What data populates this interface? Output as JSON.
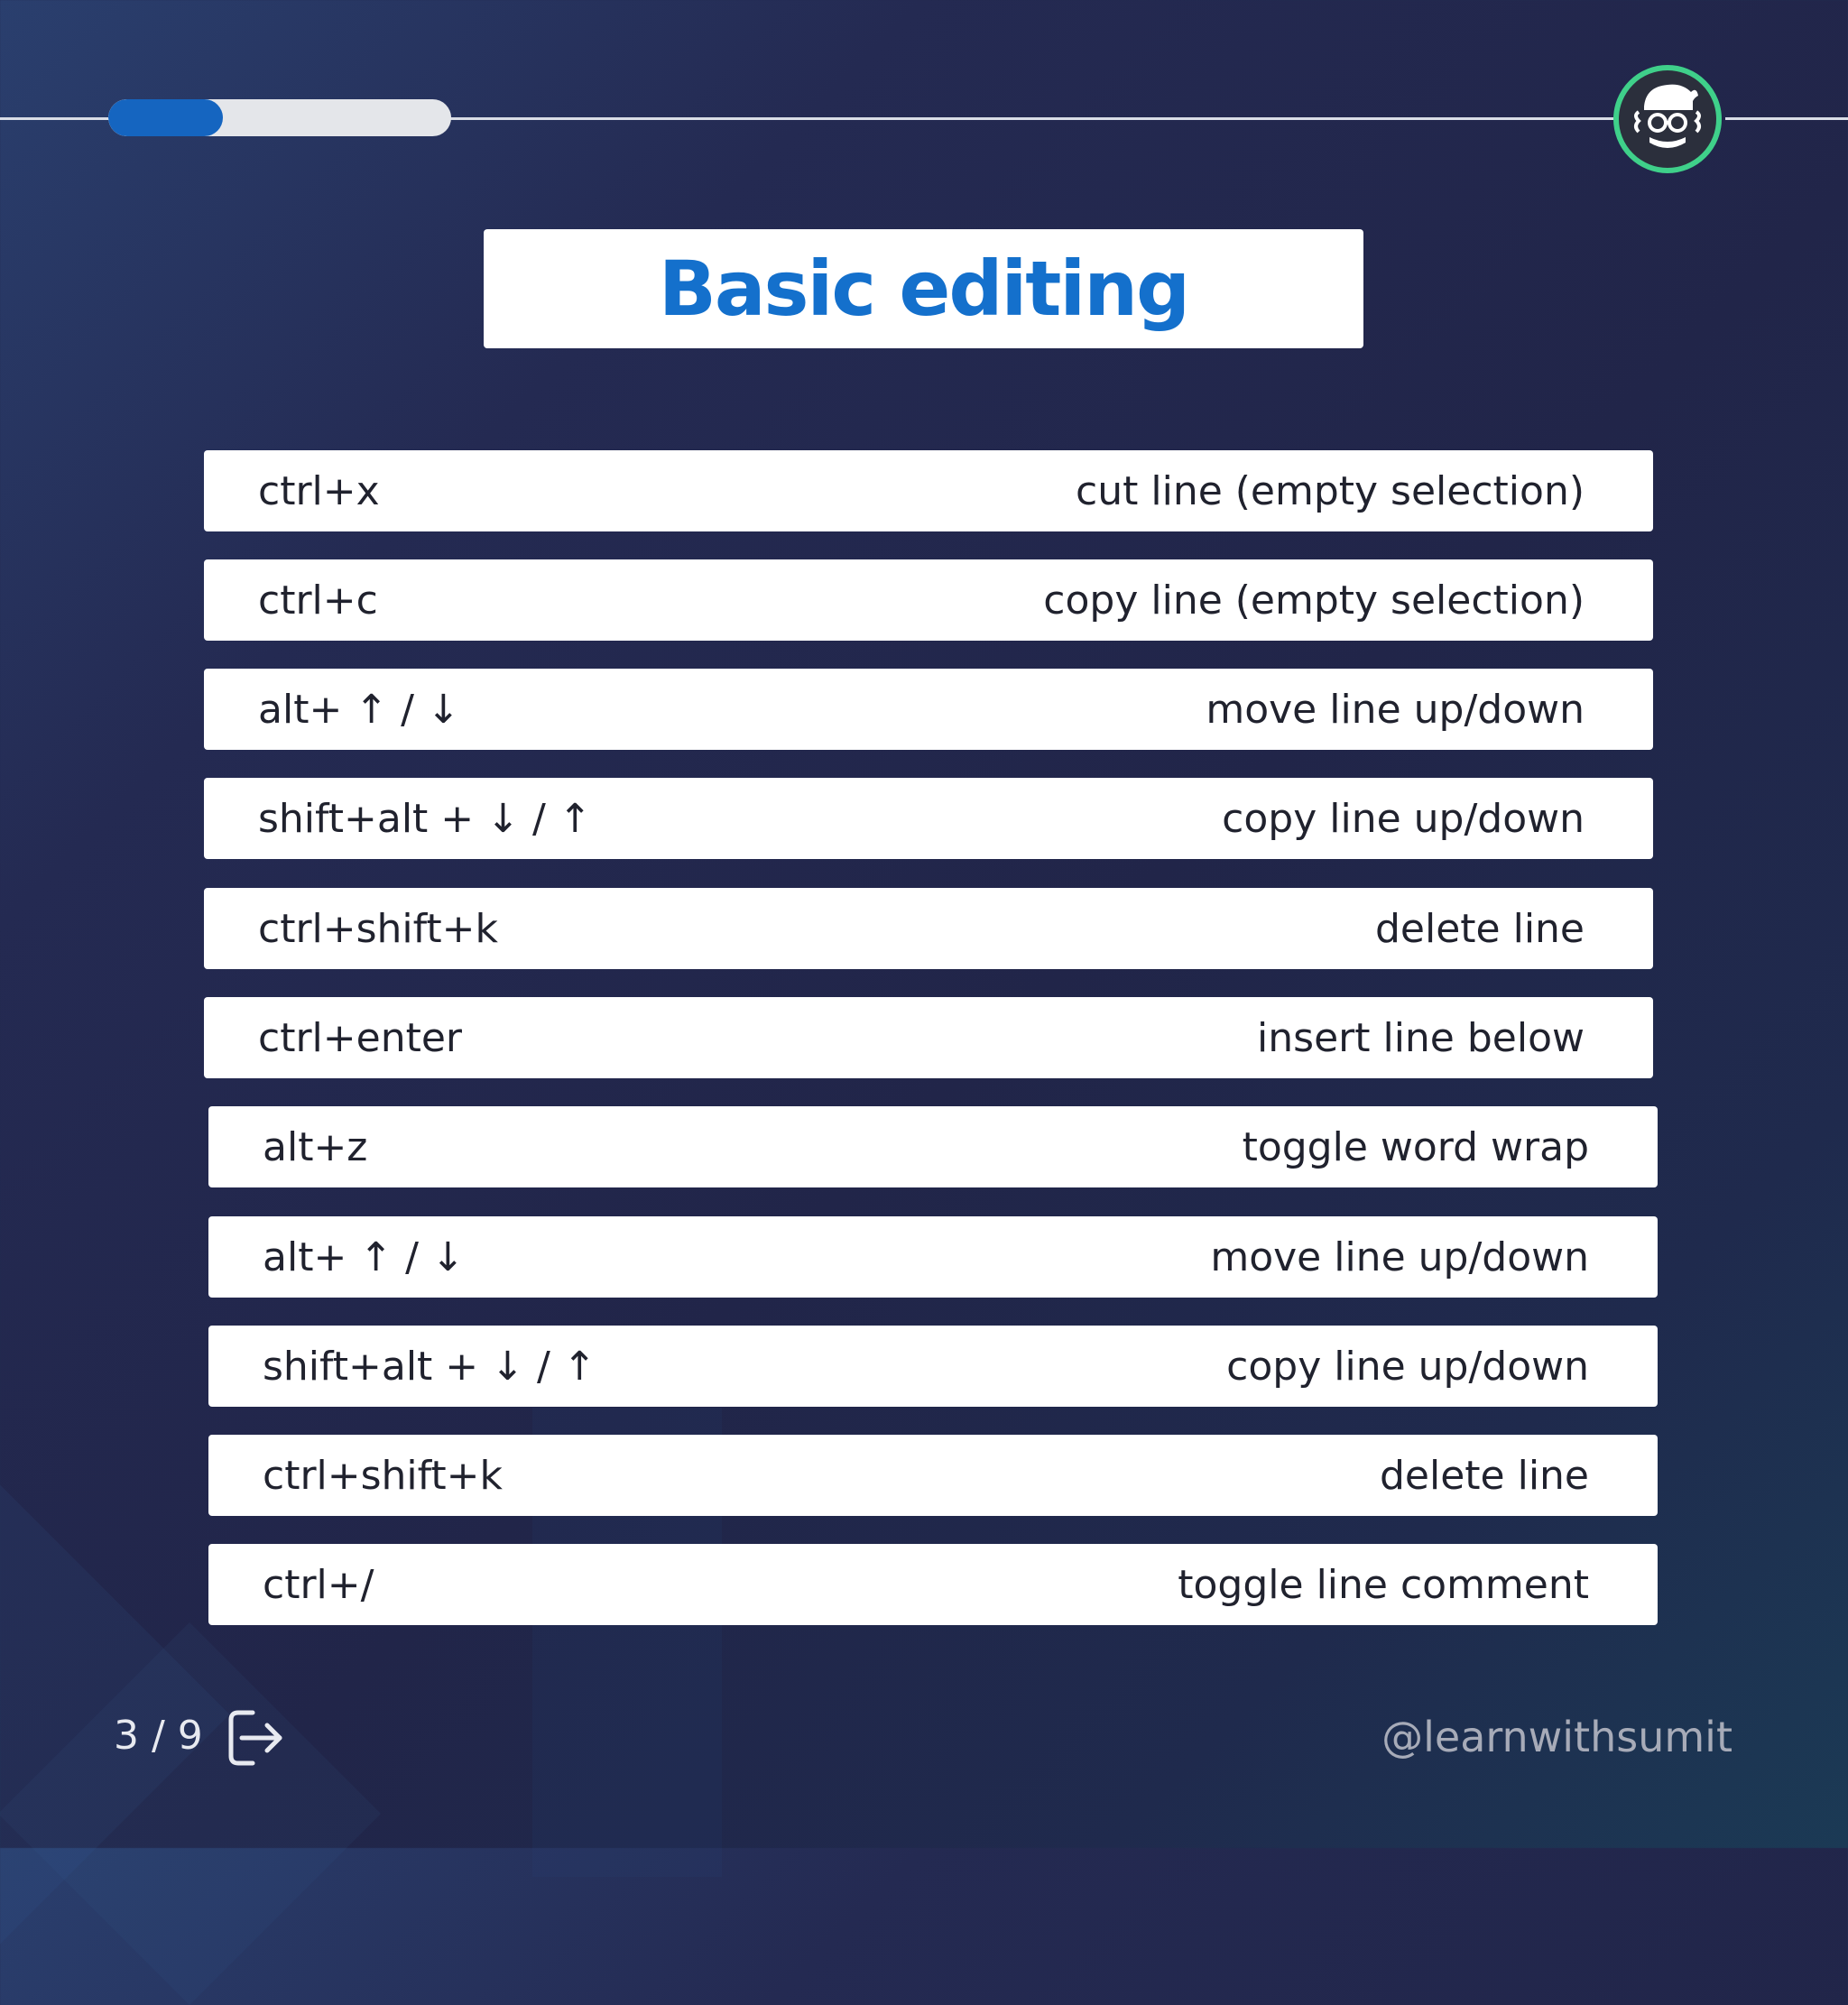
{
  "header": {
    "progress_fraction": 0.333
  },
  "title": "Basic editing",
  "shortcuts": [
    {
      "keys": "ctrl+x",
      "action": "cut line (empty selection)"
    },
    {
      "keys": "ctrl+c",
      "action": "copy line (empty selection)"
    },
    {
      "keys": "alt+ ↑ / ↓",
      "action": "move line up/down"
    },
    {
      "keys": "shift+alt + ↓ / ↑",
      "action": "copy line up/down"
    },
    {
      "keys": "ctrl+shift+k",
      "action": "delete line"
    },
    {
      "keys": "ctrl+enter",
      "action": "insert line below"
    },
    {
      "keys": "alt+z",
      "action": "toggle word wrap"
    },
    {
      "keys": "alt+ ↑ / ↓",
      "action": "move line up/down"
    },
    {
      "keys": "shift+alt + ↓ / ↑",
      "action": "copy line up/down"
    },
    {
      "keys": "ctrl+shift+k",
      "action": "delete line"
    },
    {
      "keys": "ctrl+/",
      "action": "toggle line comment"
    }
  ],
  "footer": {
    "page_indicator": "3 / 9",
    "handle": "@learnwithsumit",
    "next_icon": "arrow-right-exit-icon"
  },
  "colors": {
    "accent": "#1470cc",
    "progress_fill": "#1565c0",
    "logo_ring": "#3fd08a"
  }
}
